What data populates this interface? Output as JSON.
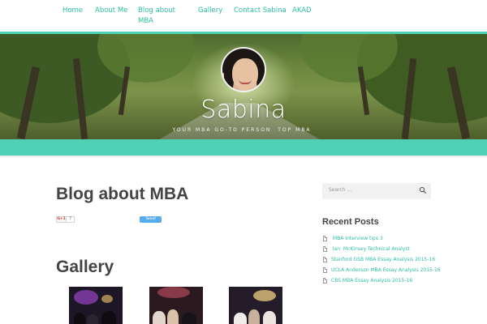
{
  "nav": {
    "items": [
      {
        "label": "Home"
      },
      {
        "label": "About Me"
      },
      {
        "label": "Blog about ​​MBA"
      },
      {
        "label": "Gallery"
      },
      {
        "label": "Contact Sabina"
      },
      {
        "label": "AKAD"
      }
    ]
  },
  "hero": {
    "title": "Sabina",
    "tagline": "YOUR MBA GO-TO PERSON ​​​​​​​​​ TOP MBA ​​​​​​"
  },
  "post": {
    "title": "Blog about ​​MBA",
    "gplus_label": "G+1",
    "gplus_count": "7",
    "tweet_label": "Tweet"
  },
  "gallery": {
    "heading": "Gallery"
  },
  "sidebar": {
    "search_placeholder": "Search ...",
    "recent_heading": "Recent Posts",
    "recent_posts": [
      "​​​​​​​​​​​​​​​​​​​​​​​​​​​​​​​​​ MBA Interview tips 3",
      "​​​​​​​​​​​​​​​​​​​​ lan ​​​​​​​ McKinsey Technical Analyst",
      "Stanford GSB MBA Essay Analysis 2015-16 ​​​​​​​​​​​​​​​​",
      "UCLA Anderson MBA Essay Analysis 2015-16 ​​​​​​​​​​​​​​​​​​​​​",
      "CBS MBA Essay Analysis 2015-16 ​​​​​​​​​​​​​​​​​​"
    ]
  },
  "colors": {
    "accent": "#4fd1b5",
    "link": "#2bbfa4"
  }
}
